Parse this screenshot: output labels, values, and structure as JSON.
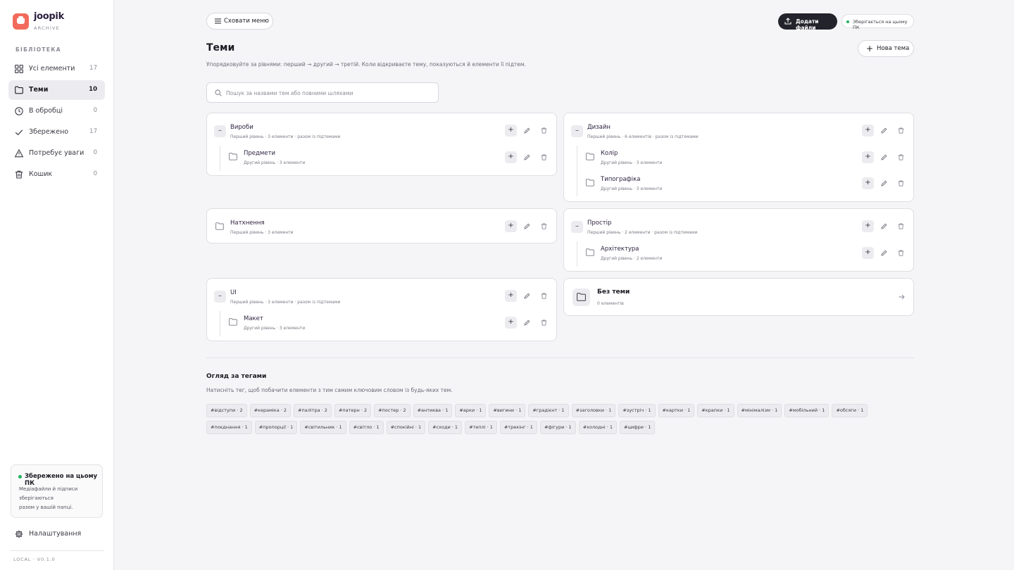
{
  "brand": {
    "name": "joopik",
    "sub": "ARCHIVE"
  },
  "sidebar": {
    "heading": "БІБЛІОТЕКА",
    "items": [
      {
        "label": "Усі елементи",
        "count": "17"
      },
      {
        "label": "Теми",
        "count": "10"
      },
      {
        "label": "В обробці",
        "count": "0"
      },
      {
        "label": "Збережено",
        "count": "17"
      },
      {
        "label": "Потребує уваги",
        "count": "0"
      },
      {
        "label": "Кошик",
        "count": "0"
      }
    ],
    "save_card": {
      "title": "Збережено на цьому ПК",
      "line1": "Медіафайли й підписи",
      "line2": "зберігаються",
      "line3": "разом у вашій папці."
    },
    "settings": "Налаштування",
    "version": "LOCAL · V0.1.0"
  },
  "toolbar": {
    "hide_menu": "Сховати меню",
    "add_files": "Додати файли",
    "status": "Зберігається на цьому ПК"
  },
  "page": {
    "title": "Теми",
    "subtitle": "Упорядковуйте за рівнями: перший → другий → третій. Коли відкриваєте тему, показуються й елементи її підтем.",
    "new_button": "Нова тема"
  },
  "search": {
    "placeholder": "Пошук за назвами тем або повними шляхами"
  },
  "topics": {
    "vyroby": {
      "toggle": "–",
      "name": "Вироби",
      "meta": "Перший рівень · 3 елементи · разом із підтемами",
      "children": [
        {
          "name": "Предмети",
          "meta": "Другий рівень · 3 елементи"
        }
      ]
    },
    "dyzain": {
      "toggle": "–",
      "name": "Дизайн",
      "meta": "Перший рівень · 6 елементів · разом із підтемами",
      "children": [
        {
          "name": "Колір",
          "meta": "Другий рівень · 3 елементи"
        },
        {
          "name": "Типографіка",
          "meta": "Другий рівень · 3 елементи"
        }
      ]
    },
    "natkhnennia": {
      "name": "Натхнення",
      "meta": "Перший рівень · 3 елементи"
    },
    "prostir": {
      "toggle": "–",
      "name": "Простір",
      "meta": "Перший рівень · 2 елементи · разом із підтемами",
      "children": [
        {
          "name": "Архітектура",
          "meta": "Другий рівень · 2 елементи"
        }
      ]
    },
    "ui": {
      "toggle": "–",
      "name": "UI",
      "meta": "Перший рівень · 3 елементи · разом із підтемами",
      "children": [
        {
          "name": "Макет",
          "meta": "Другий рівень · 3 елементи"
        }
      ]
    },
    "bez_temy": {
      "name": "Без теми",
      "meta": "0 елементів"
    }
  },
  "actions": {
    "add": "+"
  },
  "tags_section": {
    "title": "Огляд за тегами",
    "subtitle": "Натисніть тег, щоб побачити елементи з тим самим ключовим словом із будь-яких тем.",
    "tags": [
      "#відступи · 2",
      "#кераміка · 2",
      "#палітра · 2",
      "#патерн · 2",
      "#постер · 2",
      "#антиква · 1",
      "#арки · 1",
      "#вигини · 1",
      "#градієнт · 1",
      "#заголовки · 1",
      "#зустріч · 1",
      "#картки · 1",
      "#крапки · 1",
      "#мінімалізм · 1",
      "#мобільний · 1",
      "#обсяги · 1",
      "#поєднання · 1",
      "#пропорції · 1",
      "#світильник · 1",
      "#світло · 1",
      "#спокійні · 1",
      "#сходи · 1",
      "#теплі · 1",
      "#трекінг · 1",
      "#фігури · 1",
      "#холодні · 1",
      "#цифри · 1"
    ]
  }
}
